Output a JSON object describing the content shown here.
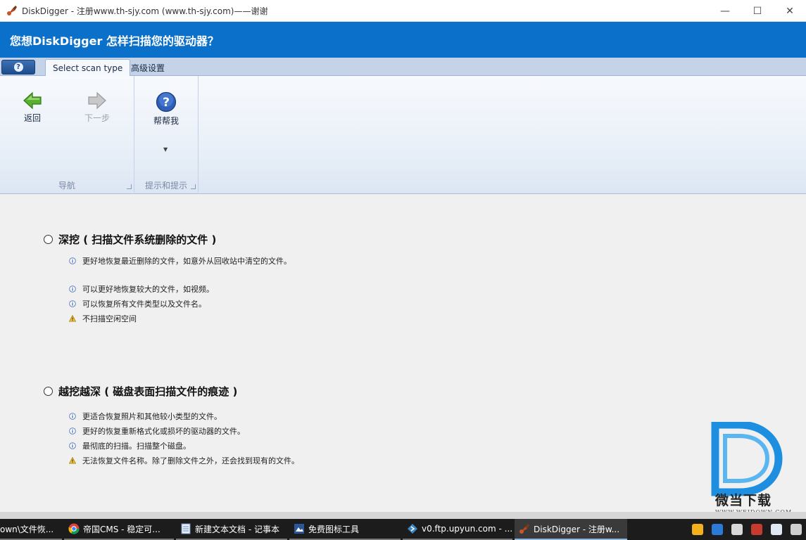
{
  "window": {
    "title": "DiskDigger - 注册www.th-sjy.com (www.th-sjy.com)——谢谢",
    "controls": {
      "minimize": "—",
      "maximize": "☐",
      "close": "✕"
    }
  },
  "header": {
    "title": "您想DiskDigger 怎样扫描您的驱动器？"
  },
  "ribbon": {
    "app_button_icon": "?",
    "tabs": [
      {
        "label": "Select scan type",
        "active": true
      },
      {
        "label": "高级设置",
        "active": false
      }
    ],
    "groups": {
      "navigation": {
        "label": "导航",
        "back_label": "返回",
        "next_label": "下一步"
      },
      "tips": {
        "label": "提示和提示",
        "help_label": "帮帮我",
        "help_icon_text": "?"
      }
    }
  },
  "options": [
    {
      "title": "深挖 ( 扫描文件系统删除的文件 )",
      "bullets": [
        {
          "type": "info",
          "text": "更好地恢复最近删除的文件，如意外从回收站中清空的文件。"
        },
        {
          "type": "info",
          "text": "可以更好地恢复较大的文件，如视频。"
        },
        {
          "type": "info",
          "text": "可以恢复所有文件类型以及文件名。"
        },
        {
          "type": "warning",
          "text": "不扫描空闲空间"
        }
      ]
    },
    {
      "title": "越挖越深 ( 磁盘表面扫描文件的痕迹 )",
      "bullets": [
        {
          "type": "info",
          "text": "更适合恢复照片和其他较小类型的文件。"
        },
        {
          "type": "info",
          "text": "更好的恢复重新格式化或损坏的驱动器的文件。"
        },
        {
          "type": "info",
          "text": "最彻底的扫描。扫描整个磁盘。"
        },
        {
          "type": "warning",
          "text": "无法恢复文件名称。除了删除文件之外，还会找到现有的文件。"
        }
      ]
    }
  ],
  "watermark": {
    "name": "微当下载",
    "url": "WWW.WEIDOWN.COM"
  },
  "taskbar": {
    "items": [
      {
        "label": "own\\文件恢...",
        "icon": "folder-icon"
      },
      {
        "label": "帝国CMS - 稳定可...",
        "icon": "chrome-icon"
      },
      {
        "label": "新建文本文档 - 记事本",
        "icon": "notepad-icon"
      },
      {
        "label": "免费图标工具",
        "icon": "image-tool-icon"
      },
      {
        "label": "v0.ftp.upyun.com - ...",
        "icon": "ftp-icon"
      },
      {
        "label": "DiskDigger - 注册w...",
        "icon": "diskdigger-icon",
        "active": true
      }
    ]
  },
  "colors": {
    "header_blue": "#0b70c9",
    "ribbon_tab_bg": "#c4d3e8",
    "content_bg": "#f0f0f0",
    "taskbar_bg": "#1c1c1c",
    "watermark_blue": "#1e8fe0"
  }
}
